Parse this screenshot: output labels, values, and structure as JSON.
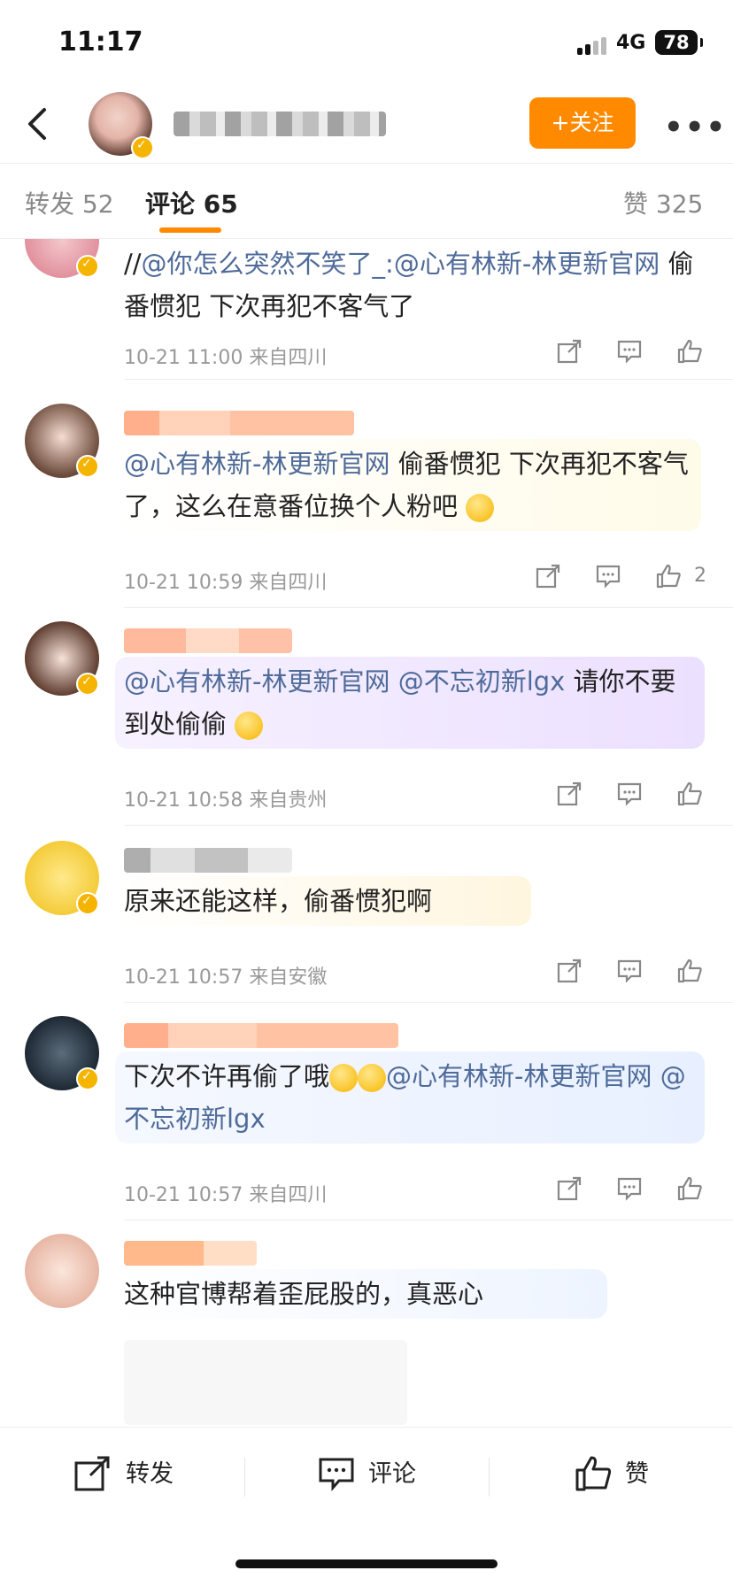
{
  "status_bar": {
    "time": "11:17",
    "network": "4G",
    "battery": "78"
  },
  "header": {
    "follow_label": "+关注",
    "more": "•••"
  },
  "tabs": [
    {
      "label": "转发 52"
    },
    {
      "label": "评论 65"
    },
    {
      "label": "赞 325"
    }
  ],
  "comments": [
    {
      "text_parts": [
        "//",
        "@你怎么突然不笑了_:",
        "@心有林新-林更新官网",
        " 偷番惯犯 下次再犯不客气了"
      ],
      "meta": "10-21 11:00  来自四川",
      "likes": ""
    },
    {
      "name": "又眠",
      "text_parts": [
        "@心有林新-林更新官网",
        " 偷番惯犯 下次再犯不客气了，这么在意番位换个人粉吧"
      ],
      "meta": "10-21 10:59  来自四川",
      "likes": "2"
    },
    {
      "name": "Starr",
      "text_parts": [
        "@心有林新-林更新官网",
        " ",
        "@不忘初新lgx",
        " 请你不要到处偷偷"
      ],
      "meta": "10-21 10:58  来自贵州",
      "likes": ""
    },
    {
      "text_parts": [
        "原来还能这样，偷番惯犯啊"
      ],
      "meta": "10-21 10:57  来自安徽",
      "likes": ""
    },
    {
      "text_parts": [
        "下次不许再偷了哦",
        "@心有林新-林更新官网",
        " ",
        "@不忘初新lgx"
      ],
      "meta": "10-21 10:57  来自四川",
      "likes": ""
    },
    {
      "name": "小芒萌",
      "text_parts": [
        "这种官博帮着歪屁股的，真恶心"
      ],
      "meta": "",
      "likes": ""
    }
  ],
  "bottom_bar": {
    "repost": "转发",
    "comment": "评论",
    "like": "赞"
  }
}
